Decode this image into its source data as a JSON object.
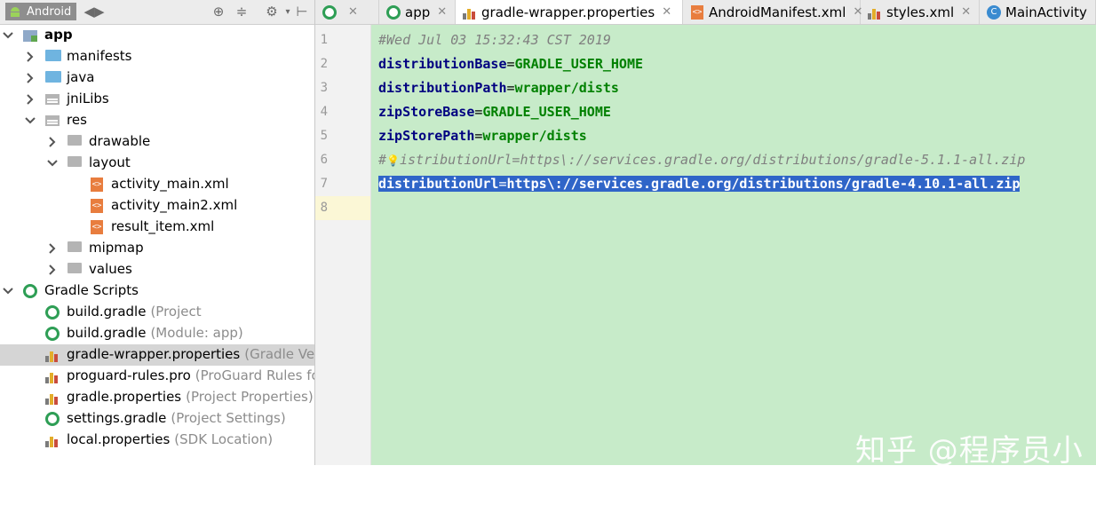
{
  "panel": {
    "view_label": "Android",
    "tree": [
      {
        "label": "app",
        "hint": "",
        "bold": true,
        "indent": 0,
        "arrow": "down",
        "icon": "module"
      },
      {
        "label": "manifests",
        "hint": "",
        "indent": 1,
        "arrow": "right",
        "icon": "folder-blue"
      },
      {
        "label": "java",
        "hint": "",
        "indent": 1,
        "arrow": "right",
        "icon": "folder-blue"
      },
      {
        "label": "jniLibs",
        "hint": "",
        "indent": 1,
        "arrow": "right",
        "icon": "folder-lib"
      },
      {
        "label": "res",
        "hint": "",
        "indent": 1,
        "arrow": "down",
        "icon": "folder-lib"
      },
      {
        "label": "drawable",
        "hint": "",
        "indent": 2,
        "arrow": "right",
        "icon": "folder-grey"
      },
      {
        "label": "layout",
        "hint": "",
        "indent": 2,
        "arrow": "down",
        "icon": "folder-grey"
      },
      {
        "label": "activity_main.xml",
        "hint": "",
        "indent": 3,
        "arrow": "",
        "icon": "xml"
      },
      {
        "label": "activity_main2.xml",
        "hint": "",
        "indent": 3,
        "arrow": "",
        "icon": "xml"
      },
      {
        "label": "result_item.xml",
        "hint": "",
        "indent": 3,
        "arrow": "",
        "icon": "xml"
      },
      {
        "label": "mipmap",
        "hint": "",
        "indent": 2,
        "arrow": "right",
        "icon": "folder-grey"
      },
      {
        "label": "values",
        "hint": "",
        "indent": 2,
        "arrow": "right",
        "icon": "folder-grey"
      },
      {
        "label": "Gradle Scripts",
        "hint": "",
        "indent": 0,
        "arrow": "down",
        "icon": "gradle"
      },
      {
        "label": "build.gradle",
        "hint": "(Project",
        "indent": 1,
        "arrow": "",
        "icon": "gradle"
      },
      {
        "label": "build.gradle",
        "hint": "(Module: app)",
        "indent": 1,
        "arrow": "",
        "icon": "gradle"
      },
      {
        "label": "gradle-wrapper.properties",
        "hint": "(Gradle Ver",
        "indent": 1,
        "arrow": "",
        "icon": "props",
        "selected": true
      },
      {
        "label": "proguard-rules.pro",
        "hint": "(ProGuard Rules fo",
        "indent": 1,
        "arrow": "",
        "icon": "props"
      },
      {
        "label": "gradle.properties",
        "hint": "(Project Properties)",
        "indent": 1,
        "arrow": "",
        "icon": "props"
      },
      {
        "label": "settings.gradle",
        "hint": "(Project Settings)",
        "indent": 1,
        "arrow": "",
        "icon": "gradle"
      },
      {
        "label": "local.properties",
        "hint": "(SDK Location)",
        "indent": 1,
        "arrow": "",
        "icon": "props"
      }
    ]
  },
  "tabs": [
    {
      "label": "",
      "icon": "gradle"
    },
    {
      "label": "app",
      "icon": "gradle"
    },
    {
      "label": "gradle-wrapper.properties",
      "icon": "props",
      "active": true
    },
    {
      "label": "AndroidManifest.xml",
      "icon": "xml"
    },
    {
      "label": "styles.xml",
      "icon": "props"
    },
    {
      "label": "MainActivity",
      "icon": "class"
    }
  ],
  "editor": {
    "lines": [
      {
        "n": "1",
        "parts": [
          {
            "t": "#Wed Jul 03 15:32:43 CST 2019",
            "c": "cmt"
          }
        ]
      },
      {
        "n": "2",
        "parts": [
          {
            "t": "distributionBase",
            "c": "key"
          },
          {
            "t": "=",
            "c": "eq"
          },
          {
            "t": "GRADLE_USER_HOME",
            "c": "val"
          }
        ]
      },
      {
        "n": "3",
        "parts": [
          {
            "t": "distributionPath",
            "c": "key"
          },
          {
            "t": "=",
            "c": "eq"
          },
          {
            "t": "wrapper/dists",
            "c": "val"
          }
        ]
      },
      {
        "n": "4",
        "parts": [
          {
            "t": "zipStoreBase",
            "c": "key"
          },
          {
            "t": "=",
            "c": "eq"
          },
          {
            "t": "GRADLE_USER_HOME",
            "c": "val"
          }
        ]
      },
      {
        "n": "5",
        "parts": [
          {
            "t": "zipStorePath",
            "c": "key"
          },
          {
            "t": "=",
            "c": "eq"
          },
          {
            "t": "wrapper/dists",
            "c": "val"
          }
        ]
      },
      {
        "n": "6",
        "parts": [
          {
            "t": "#",
            "c": "cmt"
          },
          {
            "t": "💡",
            "c": "bulb"
          },
          {
            "t": "istributionUrl=https\\://services.gradle.org/distributions/gradle-5.1.1-all.zip",
            "c": "cmt"
          }
        ]
      },
      {
        "n": "7",
        "selected": true,
        "parts": [
          {
            "t": "distributionUrl",
            "c": "key"
          },
          {
            "t": "=",
            "c": "eq"
          },
          {
            "t": "https\\://services.gradle.org/distributions/gradle-4.10.1-all.zip",
            "c": "val"
          }
        ]
      },
      {
        "n": "8",
        "parts": []
      }
    ]
  },
  "watermark": {
    "main": "知乎 @程序员小度",
    "url": "https://blog.csdn.net/sarsscofy"
  }
}
